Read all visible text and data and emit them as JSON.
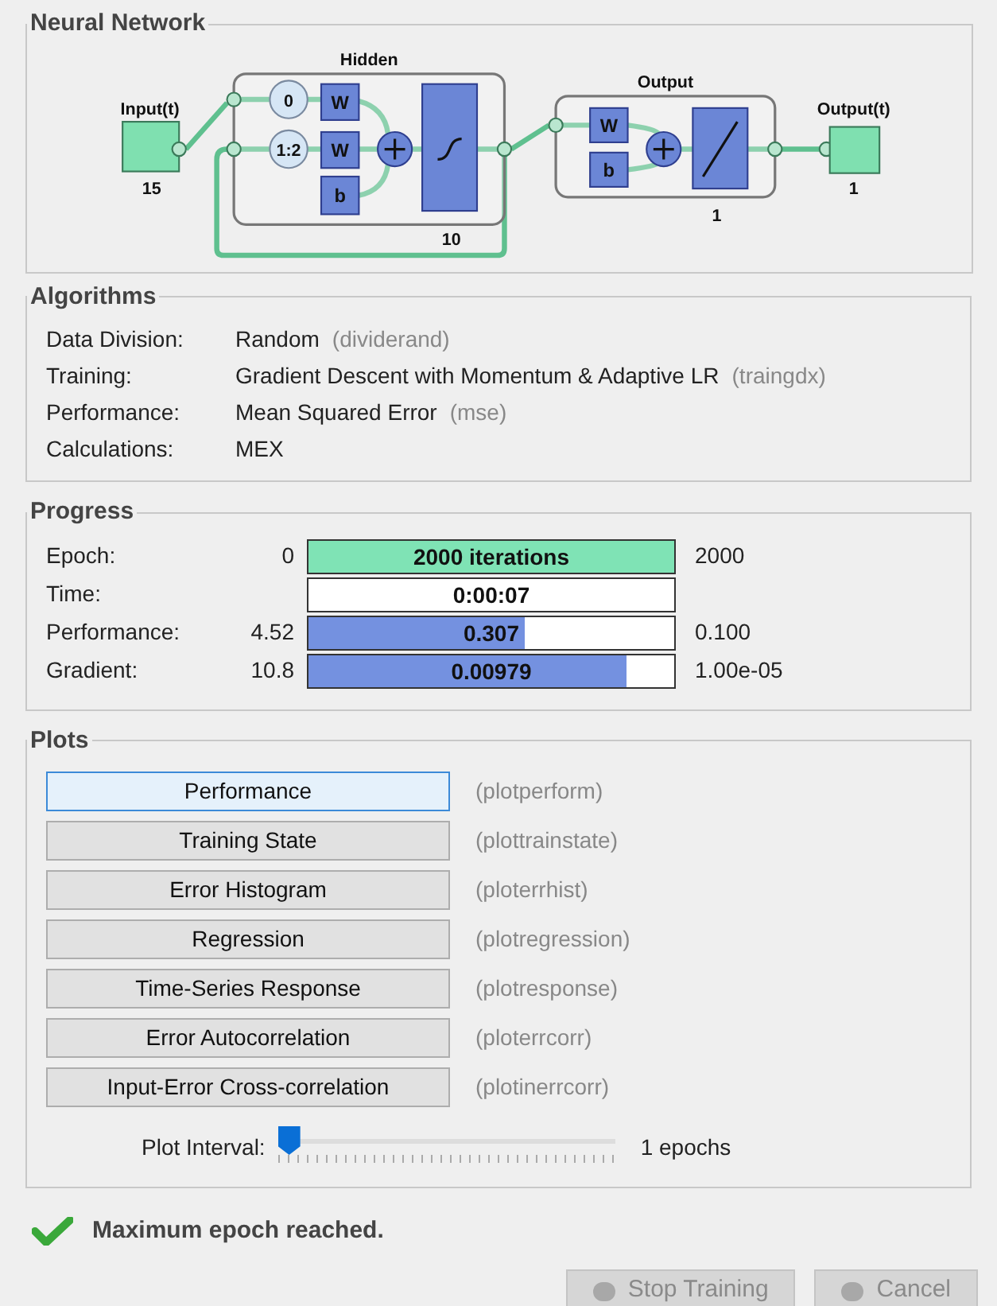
{
  "network": {
    "title": "Neural Network",
    "input": {
      "label": "Input(t)",
      "size": "15"
    },
    "hidden": {
      "title": "Hidden",
      "delays": [
        "0",
        "1:2"
      ],
      "weights": [
        "W",
        "W"
      ],
      "bias": "b",
      "size": "10"
    },
    "output_layer": {
      "title": "Output",
      "weight": "W",
      "bias": "b",
      "size": "1"
    },
    "output": {
      "label": "Output(t)",
      "size": "1"
    }
  },
  "algorithms": {
    "title": "Algorithms",
    "rows": [
      {
        "label": "Data Division:",
        "value": "Random",
        "fn": "(dividerand)"
      },
      {
        "label": "Training:",
        "value": "Gradient Descent with Momentum & Adaptive LR",
        "fn": "(traingdx)"
      },
      {
        "label": "Performance:",
        "value": "Mean Squared Error",
        "fn": "(mse)"
      },
      {
        "label": "Calculations:",
        "value": "MEX"
      }
    ]
  },
  "progress": {
    "title": "Progress",
    "rows": [
      {
        "kind": "epoch",
        "label": "Epoch:",
        "start": "0",
        "bar_text": "2000 iterations",
        "level": 1,
        "end": "2000"
      },
      {
        "kind": "time",
        "label": "Time:",
        "bar_text": "0:00:07"
      },
      {
        "kind": "metric",
        "label": "Performance:",
        "start": "4.52",
        "bar_text": "0.307",
        "level": 0.59,
        "end": "0.100"
      },
      {
        "kind": "metric",
        "label": "Gradient:",
        "start": "10.8",
        "bar_text": "0.00979",
        "level": 0.87,
        "end": "1.00e-05"
      }
    ]
  },
  "plots": {
    "title": "Plots",
    "buttons": [
      {
        "label": "Performance",
        "fn": "(plotperform)",
        "selected": true
      },
      {
        "label": "Training State",
        "fn": "(plottrainstate)",
        "selected": false
      },
      {
        "label": "Error Histogram",
        "fn": "(ploterrhist)",
        "selected": false
      },
      {
        "label": "Regression",
        "fn": "(plotregression)",
        "selected": false
      },
      {
        "label": "Time-Series Response",
        "fn": "(plotresponse)",
        "selected": false
      },
      {
        "label": "Error Autocorrelation",
        "fn": "(ploterrcorr)",
        "selected": false
      },
      {
        "label": "Input-Error Cross-correlation",
        "fn": "(plotinerrcorr)",
        "selected": false
      }
    ],
    "interval": {
      "label": "Plot Interval:",
      "level": 0,
      "reading": "1 epochs"
    }
  },
  "status": {
    "text": "Maximum epoch reached."
  },
  "buttons": [
    {
      "label": "Stop Training",
      "disabled": true
    },
    {
      "label": "Cancel",
      "disabled": true
    }
  ]
}
